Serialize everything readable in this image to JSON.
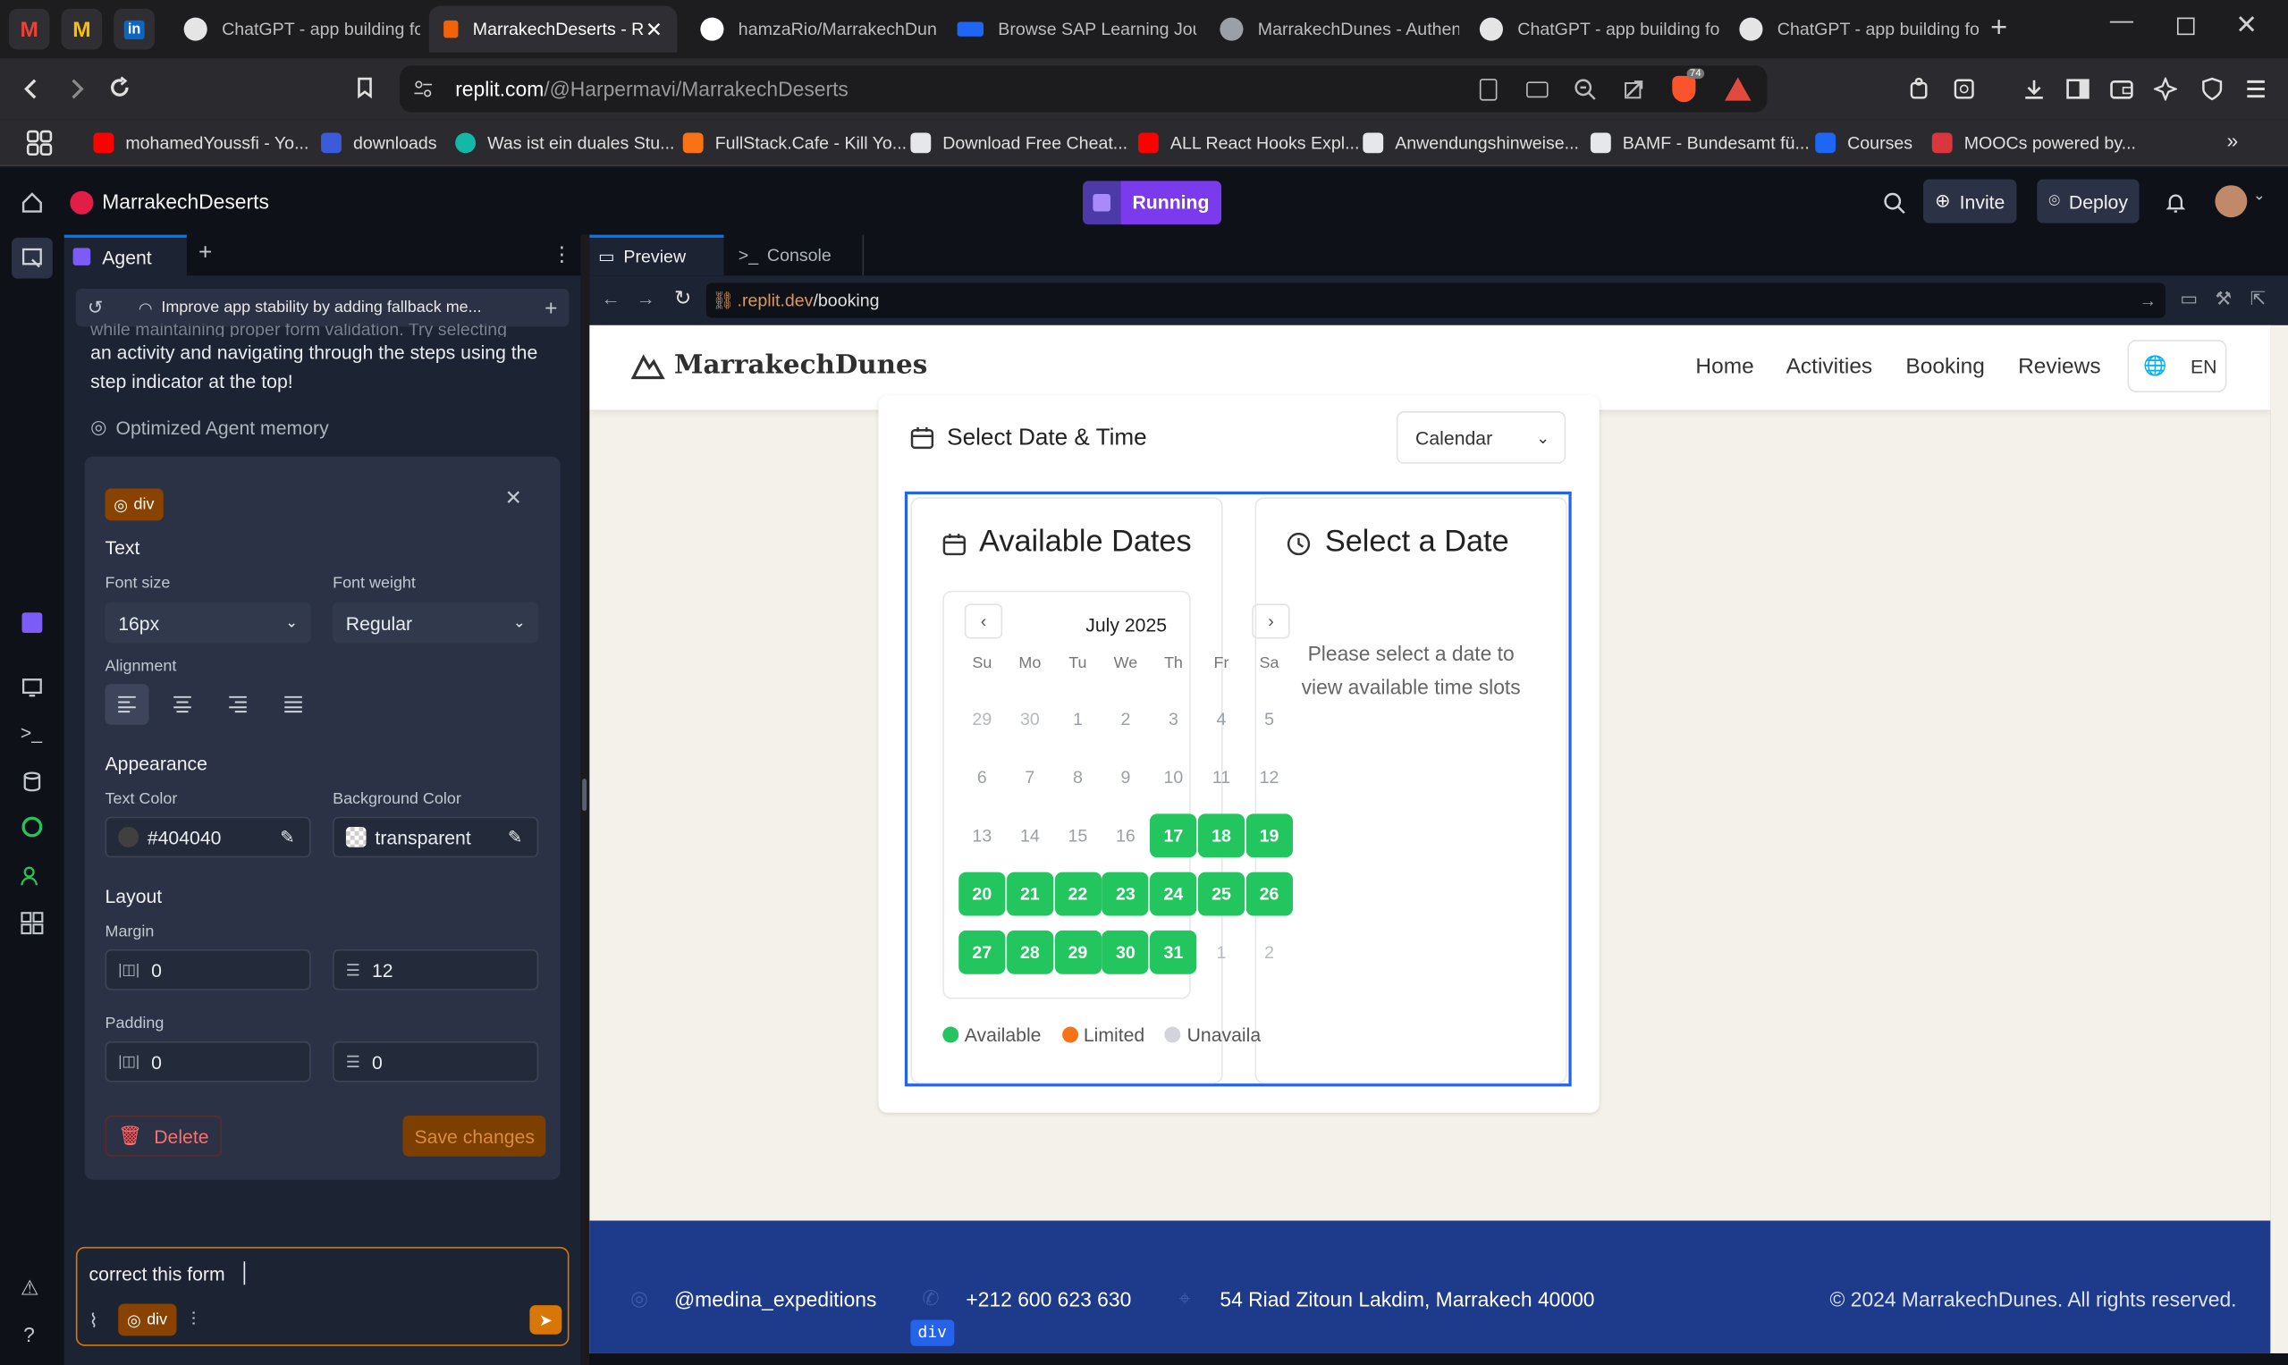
{
  "browser": {
    "tabs": [
      {
        "label": "ChatGPT - app building fo",
        "active": false
      },
      {
        "label": "MarrakechDeserts - R",
        "active": true
      },
      {
        "label": "hamzaRio/MarrakechDun",
        "active": false
      },
      {
        "label": "Browse SAP Learning Jour",
        "active": false
      },
      {
        "label": "MarrakechDunes - Authen",
        "active": false
      },
      {
        "label": "ChatGPT - app building fo",
        "active": false
      },
      {
        "label": "ChatGPT - app building fo",
        "active": false
      }
    ],
    "url_host": "replit.com",
    "url_path": "/@Harpermavi/MarrakechDeserts",
    "shield_count": "74",
    "bookmarks": [
      {
        "label": "mohamedYoussfi - Yo...",
        "color": "#ff0000"
      },
      {
        "label": "downloads",
        "color": "#3b5bdb"
      },
      {
        "label": "Was ist ein duales Stu...",
        "color": "#14b8a6"
      },
      {
        "label": "FullStack.Cafe - Kill Yo...",
        "color": "#f97316"
      },
      {
        "label": "Download Free Cheat...",
        "color": "#e5e7eb"
      },
      {
        "label": "ALL React Hooks Expl...",
        "color": "#ff0000"
      },
      {
        "label": "Anwendungshinweise...",
        "color": "#e5e7eb"
      },
      {
        "label": "BAMF - Bundesamt fü...",
        "color": "#e5e7eb"
      },
      {
        "label": "Courses",
        "color": "#1e66f5"
      },
      {
        "label": "MOOCs powered by...",
        "color": "#d9363e"
      }
    ]
  },
  "replit": {
    "project_name": "MarrakechDeserts",
    "run_status": "Running",
    "invite_label": "Invite",
    "deploy_label": "Deploy",
    "agent_tab": "Agent",
    "preview_tab": "Preview",
    "console_tab": "Console",
    "checkpoint_text": "Improve app stability by adding fallback me...",
    "chat_faded": "while maintaining proper form validation. Try selecting",
    "chat_line1": "an activity and navigating through the steps using the",
    "chat_line2": "step indicator at the top!",
    "memory_note": "Optimized Agent memory",
    "preview_url_prefix": ".replit.dev",
    "preview_url_path": "/booking"
  },
  "inspector": {
    "element_tag": "div",
    "section_text": "Text",
    "font_size_label": "Font size",
    "font_size_value": "16px",
    "font_weight_label": "Font weight",
    "font_weight_value": "Regular",
    "alignment_label": "Alignment",
    "appearance_label": "Appearance",
    "text_color_label": "Text Color",
    "text_color_value": "#404040",
    "bg_color_label": "Background Color",
    "bg_color_value": "transparent",
    "layout_label": "Layout",
    "margin_label": "Margin",
    "margin_x": "0",
    "margin_y": "12",
    "padding_label": "Padding",
    "padding_x": "0",
    "padding_y": "0",
    "delete_label": "Delete",
    "save_label": "Save changes"
  },
  "chat_input": {
    "value": "correct this form",
    "chip": "div"
  },
  "site": {
    "brand": "MarrakechDunes",
    "nav": [
      "Home",
      "Activities",
      "Booking",
      "Reviews"
    ],
    "lang": "EN",
    "section_title": "Select Date & Time",
    "view_select": "Calendar",
    "available_title": "Available Dates",
    "select_title": "Select a Date",
    "select_hint_1": "Please select a date to",
    "select_hint_2": "view available time slots",
    "month": "July 2025",
    "weekdays": [
      "Su",
      "Mo",
      "Tu",
      "We",
      "Th",
      "Fr",
      "Sa"
    ],
    "weeks": [
      [
        {
          "d": "29",
          "s": "o"
        },
        {
          "d": "30",
          "s": "o"
        },
        {
          "d": "1",
          "s": "u"
        },
        {
          "d": "2",
          "s": "u"
        },
        {
          "d": "3",
          "s": "u"
        },
        {
          "d": "4",
          "s": "u"
        },
        {
          "d": "5",
          "s": "u"
        }
      ],
      [
        {
          "d": "6",
          "s": "u"
        },
        {
          "d": "7",
          "s": "u"
        },
        {
          "d": "8",
          "s": "u"
        },
        {
          "d": "9",
          "s": "u"
        },
        {
          "d": "10",
          "s": "u"
        },
        {
          "d": "11",
          "s": "u"
        },
        {
          "d": "12",
          "s": "u"
        }
      ],
      [
        {
          "d": "13",
          "s": "u"
        },
        {
          "d": "14",
          "s": "u"
        },
        {
          "d": "15",
          "s": "u"
        },
        {
          "d": "16",
          "s": "u"
        },
        {
          "d": "17",
          "s": "a"
        },
        {
          "d": "18",
          "s": "a"
        },
        {
          "d": "19",
          "s": "a"
        }
      ],
      [
        {
          "d": "20",
          "s": "a"
        },
        {
          "d": "21",
          "s": "a"
        },
        {
          "d": "22",
          "s": "a"
        },
        {
          "d": "23",
          "s": "a"
        },
        {
          "d": "24",
          "s": "a"
        },
        {
          "d": "25",
          "s": "a"
        },
        {
          "d": "26",
          "s": "a"
        }
      ],
      [
        {
          "d": "27",
          "s": "a"
        },
        {
          "d": "28",
          "s": "a"
        },
        {
          "d": "29",
          "s": "a"
        },
        {
          "d": "30",
          "s": "a"
        },
        {
          "d": "31",
          "s": "a"
        },
        {
          "d": "1",
          "s": "o"
        },
        {
          "d": "2",
          "s": "o"
        }
      ]
    ],
    "legend": [
      {
        "label": "Available",
        "color": "#22c55e"
      },
      {
        "label": "Limited",
        "color": "#f97316"
      },
      {
        "label": "Unavaila",
        "color": "#d1d5db"
      }
    ],
    "footer_social": "@medina_expeditions",
    "footer_phone": "+212 600 623 630",
    "footer_address": "54 Riad Zitoun Lakdim, Marrakech 40000",
    "footer_copy": "© 2024 MarrakechDunes. All rights reserved.",
    "footer_chip": "div"
  },
  "colors": {
    "accent": "#7c3aed",
    "available": "#22c55e",
    "footer": "#1e3a8a",
    "save": "#7c3f00"
  }
}
